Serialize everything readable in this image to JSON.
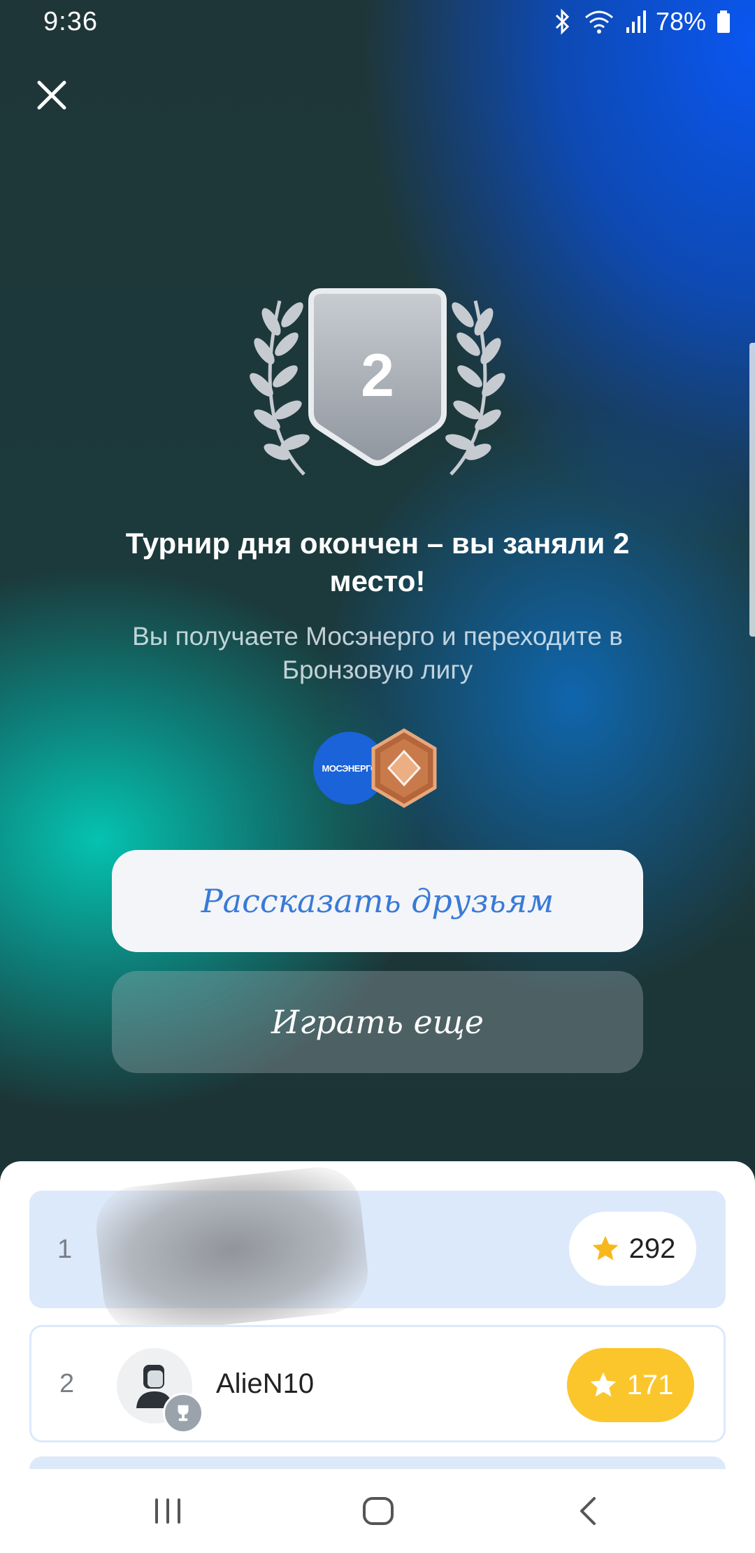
{
  "status_bar": {
    "time": "9:36",
    "battery": "78%"
  },
  "medal": {
    "place": "2"
  },
  "result": {
    "title": "Турнир дня окончен – вы заняли 2 место!",
    "subtitle": "Вы получаете Мосэнерго и переходите в Бронзовую лигу"
  },
  "rewards": {
    "sponsor_logo_text": "МОСЭНЕРГО"
  },
  "buttons": {
    "share_label": "Рассказать друзьям",
    "play_again_label": "Играть еще"
  },
  "leaderboard": {
    "rows": [
      {
        "rank": "1",
        "name": "",
        "score": "292"
      },
      {
        "rank": "2",
        "name": "AlieN10",
        "score": "171"
      }
    ]
  },
  "colors": {
    "accent_blue": "#3a7ad6",
    "highlight_row": "#dce9fb",
    "gold": "#fbc62b",
    "bronze": "#c97a4a"
  }
}
